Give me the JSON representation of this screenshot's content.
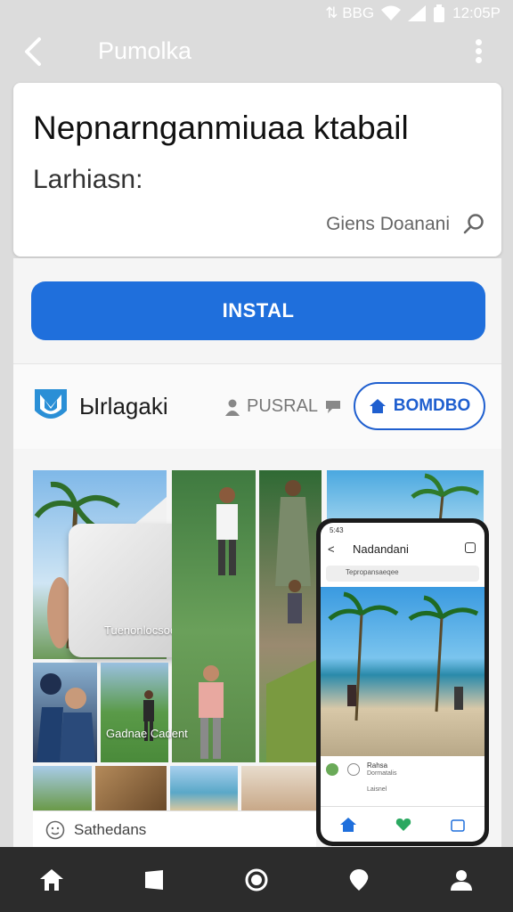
{
  "status_bar": {
    "left_indicators": "⇅ BBG",
    "time": "12:05P"
  },
  "app_bar": {
    "title": "Pumolka"
  },
  "header": {
    "title": "Nepnarnganmiuaa ktabail",
    "subtitle": "Larhiasn:",
    "search_label": "Giens Doanani"
  },
  "install_button": "INSTAL",
  "developer": {
    "name": "Ыrlagaki",
    "user_label": "PUSRAL",
    "follow_label": "BOMDBO"
  },
  "gallery": {
    "caption_1": "Tuenonlocsook",
    "caption_2": "Gadnae Cadent"
  },
  "phone": {
    "time": "5:43",
    "title": "Nadandani",
    "subtitle": "Tepropansaeqee",
    "row_label": "Rahsa",
    "row_sub": "Dormatalis",
    "row_more": "Laisnel"
  },
  "more_bar_label": "Sathedans",
  "colors": {
    "accent": "#1f6fdc",
    "follow_border": "#1f5fcf",
    "nav_bg": "#2c2c2c"
  }
}
